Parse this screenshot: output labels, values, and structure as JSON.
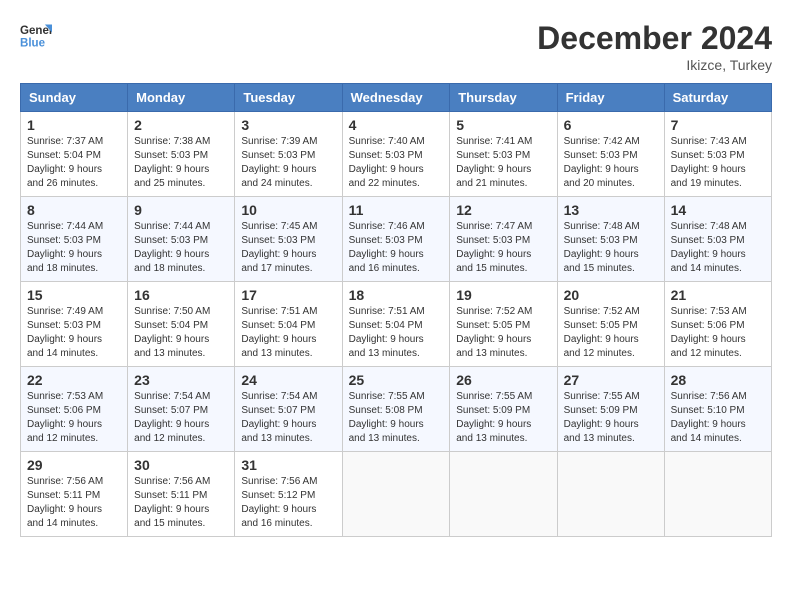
{
  "header": {
    "logo_line1": "General",
    "logo_line2": "Blue",
    "month_title": "December 2024",
    "location": "Ikizce, Turkey"
  },
  "weekdays": [
    "Sunday",
    "Monday",
    "Tuesday",
    "Wednesday",
    "Thursday",
    "Friday",
    "Saturday"
  ],
  "weeks": [
    [
      {
        "day": "1",
        "lines": [
          "Sunrise: 7:37 AM",
          "Sunset: 5:04 PM",
          "Daylight: 9 hours",
          "and 26 minutes."
        ]
      },
      {
        "day": "2",
        "lines": [
          "Sunrise: 7:38 AM",
          "Sunset: 5:03 PM",
          "Daylight: 9 hours",
          "and 25 minutes."
        ]
      },
      {
        "day": "3",
        "lines": [
          "Sunrise: 7:39 AM",
          "Sunset: 5:03 PM",
          "Daylight: 9 hours",
          "and 24 minutes."
        ]
      },
      {
        "day": "4",
        "lines": [
          "Sunrise: 7:40 AM",
          "Sunset: 5:03 PM",
          "Daylight: 9 hours",
          "and 22 minutes."
        ]
      },
      {
        "day": "5",
        "lines": [
          "Sunrise: 7:41 AM",
          "Sunset: 5:03 PM",
          "Daylight: 9 hours",
          "and 21 minutes."
        ]
      },
      {
        "day": "6",
        "lines": [
          "Sunrise: 7:42 AM",
          "Sunset: 5:03 PM",
          "Daylight: 9 hours",
          "and 20 minutes."
        ]
      },
      {
        "day": "7",
        "lines": [
          "Sunrise: 7:43 AM",
          "Sunset: 5:03 PM",
          "Daylight: 9 hours",
          "and 19 minutes."
        ]
      }
    ],
    [
      {
        "day": "8",
        "lines": [
          "Sunrise: 7:44 AM",
          "Sunset: 5:03 PM",
          "Daylight: 9 hours",
          "and 18 minutes."
        ]
      },
      {
        "day": "9",
        "lines": [
          "Sunrise: 7:44 AM",
          "Sunset: 5:03 PM",
          "Daylight: 9 hours",
          "and 18 minutes."
        ]
      },
      {
        "day": "10",
        "lines": [
          "Sunrise: 7:45 AM",
          "Sunset: 5:03 PM",
          "Daylight: 9 hours",
          "and 17 minutes."
        ]
      },
      {
        "day": "11",
        "lines": [
          "Sunrise: 7:46 AM",
          "Sunset: 5:03 PM",
          "Daylight: 9 hours",
          "and 16 minutes."
        ]
      },
      {
        "day": "12",
        "lines": [
          "Sunrise: 7:47 AM",
          "Sunset: 5:03 PM",
          "Daylight: 9 hours",
          "and 15 minutes."
        ]
      },
      {
        "day": "13",
        "lines": [
          "Sunrise: 7:48 AM",
          "Sunset: 5:03 PM",
          "Daylight: 9 hours",
          "and 15 minutes."
        ]
      },
      {
        "day": "14",
        "lines": [
          "Sunrise: 7:48 AM",
          "Sunset: 5:03 PM",
          "Daylight: 9 hours",
          "and 14 minutes."
        ]
      }
    ],
    [
      {
        "day": "15",
        "lines": [
          "Sunrise: 7:49 AM",
          "Sunset: 5:03 PM",
          "Daylight: 9 hours",
          "and 14 minutes."
        ]
      },
      {
        "day": "16",
        "lines": [
          "Sunrise: 7:50 AM",
          "Sunset: 5:04 PM",
          "Daylight: 9 hours",
          "and 13 minutes."
        ]
      },
      {
        "day": "17",
        "lines": [
          "Sunrise: 7:51 AM",
          "Sunset: 5:04 PM",
          "Daylight: 9 hours",
          "and 13 minutes."
        ]
      },
      {
        "day": "18",
        "lines": [
          "Sunrise: 7:51 AM",
          "Sunset: 5:04 PM",
          "Daylight: 9 hours",
          "and 13 minutes."
        ]
      },
      {
        "day": "19",
        "lines": [
          "Sunrise: 7:52 AM",
          "Sunset: 5:05 PM",
          "Daylight: 9 hours",
          "and 13 minutes."
        ]
      },
      {
        "day": "20",
        "lines": [
          "Sunrise: 7:52 AM",
          "Sunset: 5:05 PM",
          "Daylight: 9 hours",
          "and 12 minutes."
        ]
      },
      {
        "day": "21",
        "lines": [
          "Sunrise: 7:53 AM",
          "Sunset: 5:06 PM",
          "Daylight: 9 hours",
          "and 12 minutes."
        ]
      }
    ],
    [
      {
        "day": "22",
        "lines": [
          "Sunrise: 7:53 AM",
          "Sunset: 5:06 PM",
          "Daylight: 9 hours",
          "and 12 minutes."
        ]
      },
      {
        "day": "23",
        "lines": [
          "Sunrise: 7:54 AM",
          "Sunset: 5:07 PM",
          "Daylight: 9 hours",
          "and 12 minutes."
        ]
      },
      {
        "day": "24",
        "lines": [
          "Sunrise: 7:54 AM",
          "Sunset: 5:07 PM",
          "Daylight: 9 hours",
          "and 13 minutes."
        ]
      },
      {
        "day": "25",
        "lines": [
          "Sunrise: 7:55 AM",
          "Sunset: 5:08 PM",
          "Daylight: 9 hours",
          "and 13 minutes."
        ]
      },
      {
        "day": "26",
        "lines": [
          "Sunrise: 7:55 AM",
          "Sunset: 5:09 PM",
          "Daylight: 9 hours",
          "and 13 minutes."
        ]
      },
      {
        "day": "27",
        "lines": [
          "Sunrise: 7:55 AM",
          "Sunset: 5:09 PM",
          "Daylight: 9 hours",
          "and 13 minutes."
        ]
      },
      {
        "day": "28",
        "lines": [
          "Sunrise: 7:56 AM",
          "Sunset: 5:10 PM",
          "Daylight: 9 hours",
          "and 14 minutes."
        ]
      }
    ],
    [
      {
        "day": "29",
        "lines": [
          "Sunrise: 7:56 AM",
          "Sunset: 5:11 PM",
          "Daylight: 9 hours",
          "and 14 minutes."
        ]
      },
      {
        "day": "30",
        "lines": [
          "Sunrise: 7:56 AM",
          "Sunset: 5:11 PM",
          "Daylight: 9 hours",
          "and 15 minutes."
        ]
      },
      {
        "day": "31",
        "lines": [
          "Sunrise: 7:56 AM",
          "Sunset: 5:12 PM",
          "Daylight: 9 hours",
          "and 16 minutes."
        ]
      },
      null,
      null,
      null,
      null
    ]
  ]
}
